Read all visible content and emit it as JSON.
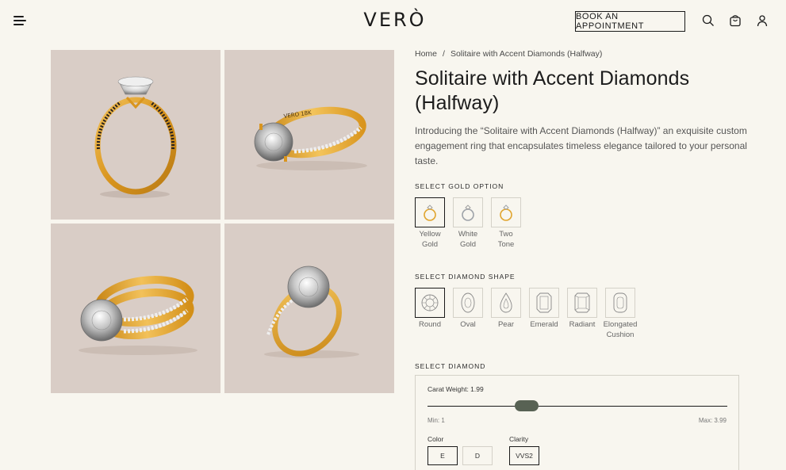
{
  "header": {
    "logo": "VERÒ",
    "book_label": "BOOK AN APPOINTMENT"
  },
  "gallery": {
    "engraving": "VERO 18K"
  },
  "breadcrumb": {
    "home": "Home",
    "separator": "/",
    "current": "Solitaire with Accent Diamonds (Halfway)"
  },
  "product": {
    "title": "Solitaire with Accent Diamonds (Halfway)",
    "description": "Introducing the “Solitaire with Accent Diamonds (Halfway)” an exquisite custom engagement ring that encapsulates timeless elegance tailored to your personal taste."
  },
  "gold": {
    "label": "SELECT GOLD OPTION",
    "options": [
      {
        "line1": "Yellow",
        "line2": "Gold"
      },
      {
        "line1": "White",
        "line2": "Gold"
      },
      {
        "line1": "Two",
        "line2": "Tone"
      }
    ]
  },
  "shape": {
    "label": "SELECT DIAMOND SHAPE",
    "options": [
      {
        "line1": "Round",
        "line2": ""
      },
      {
        "line1": "Oval",
        "line2": ""
      },
      {
        "line1": "Pear",
        "line2": ""
      },
      {
        "line1": "Emerald",
        "line2": ""
      },
      {
        "line1": "Radiant",
        "line2": ""
      },
      {
        "line1": "Elongated",
        "line2": "Cushion"
      }
    ]
  },
  "diamond": {
    "label": "SELECT DIAMOND",
    "carat_label": "Carat Weight: 1.99",
    "carat_value": 1.99,
    "min": 1,
    "max": 3.99,
    "min_label": "Min: 1",
    "max_label": "Max: 3.99",
    "color_label": "Color",
    "colors": [
      "E",
      "D"
    ],
    "clarity_label": "Clarity",
    "clarities": [
      "VVS2"
    ]
  },
  "colors": {
    "background": "#f8f6ef",
    "tile": "#d9cdc6",
    "gold": "#e0a42c",
    "slider_thumb": "#586254"
  }
}
